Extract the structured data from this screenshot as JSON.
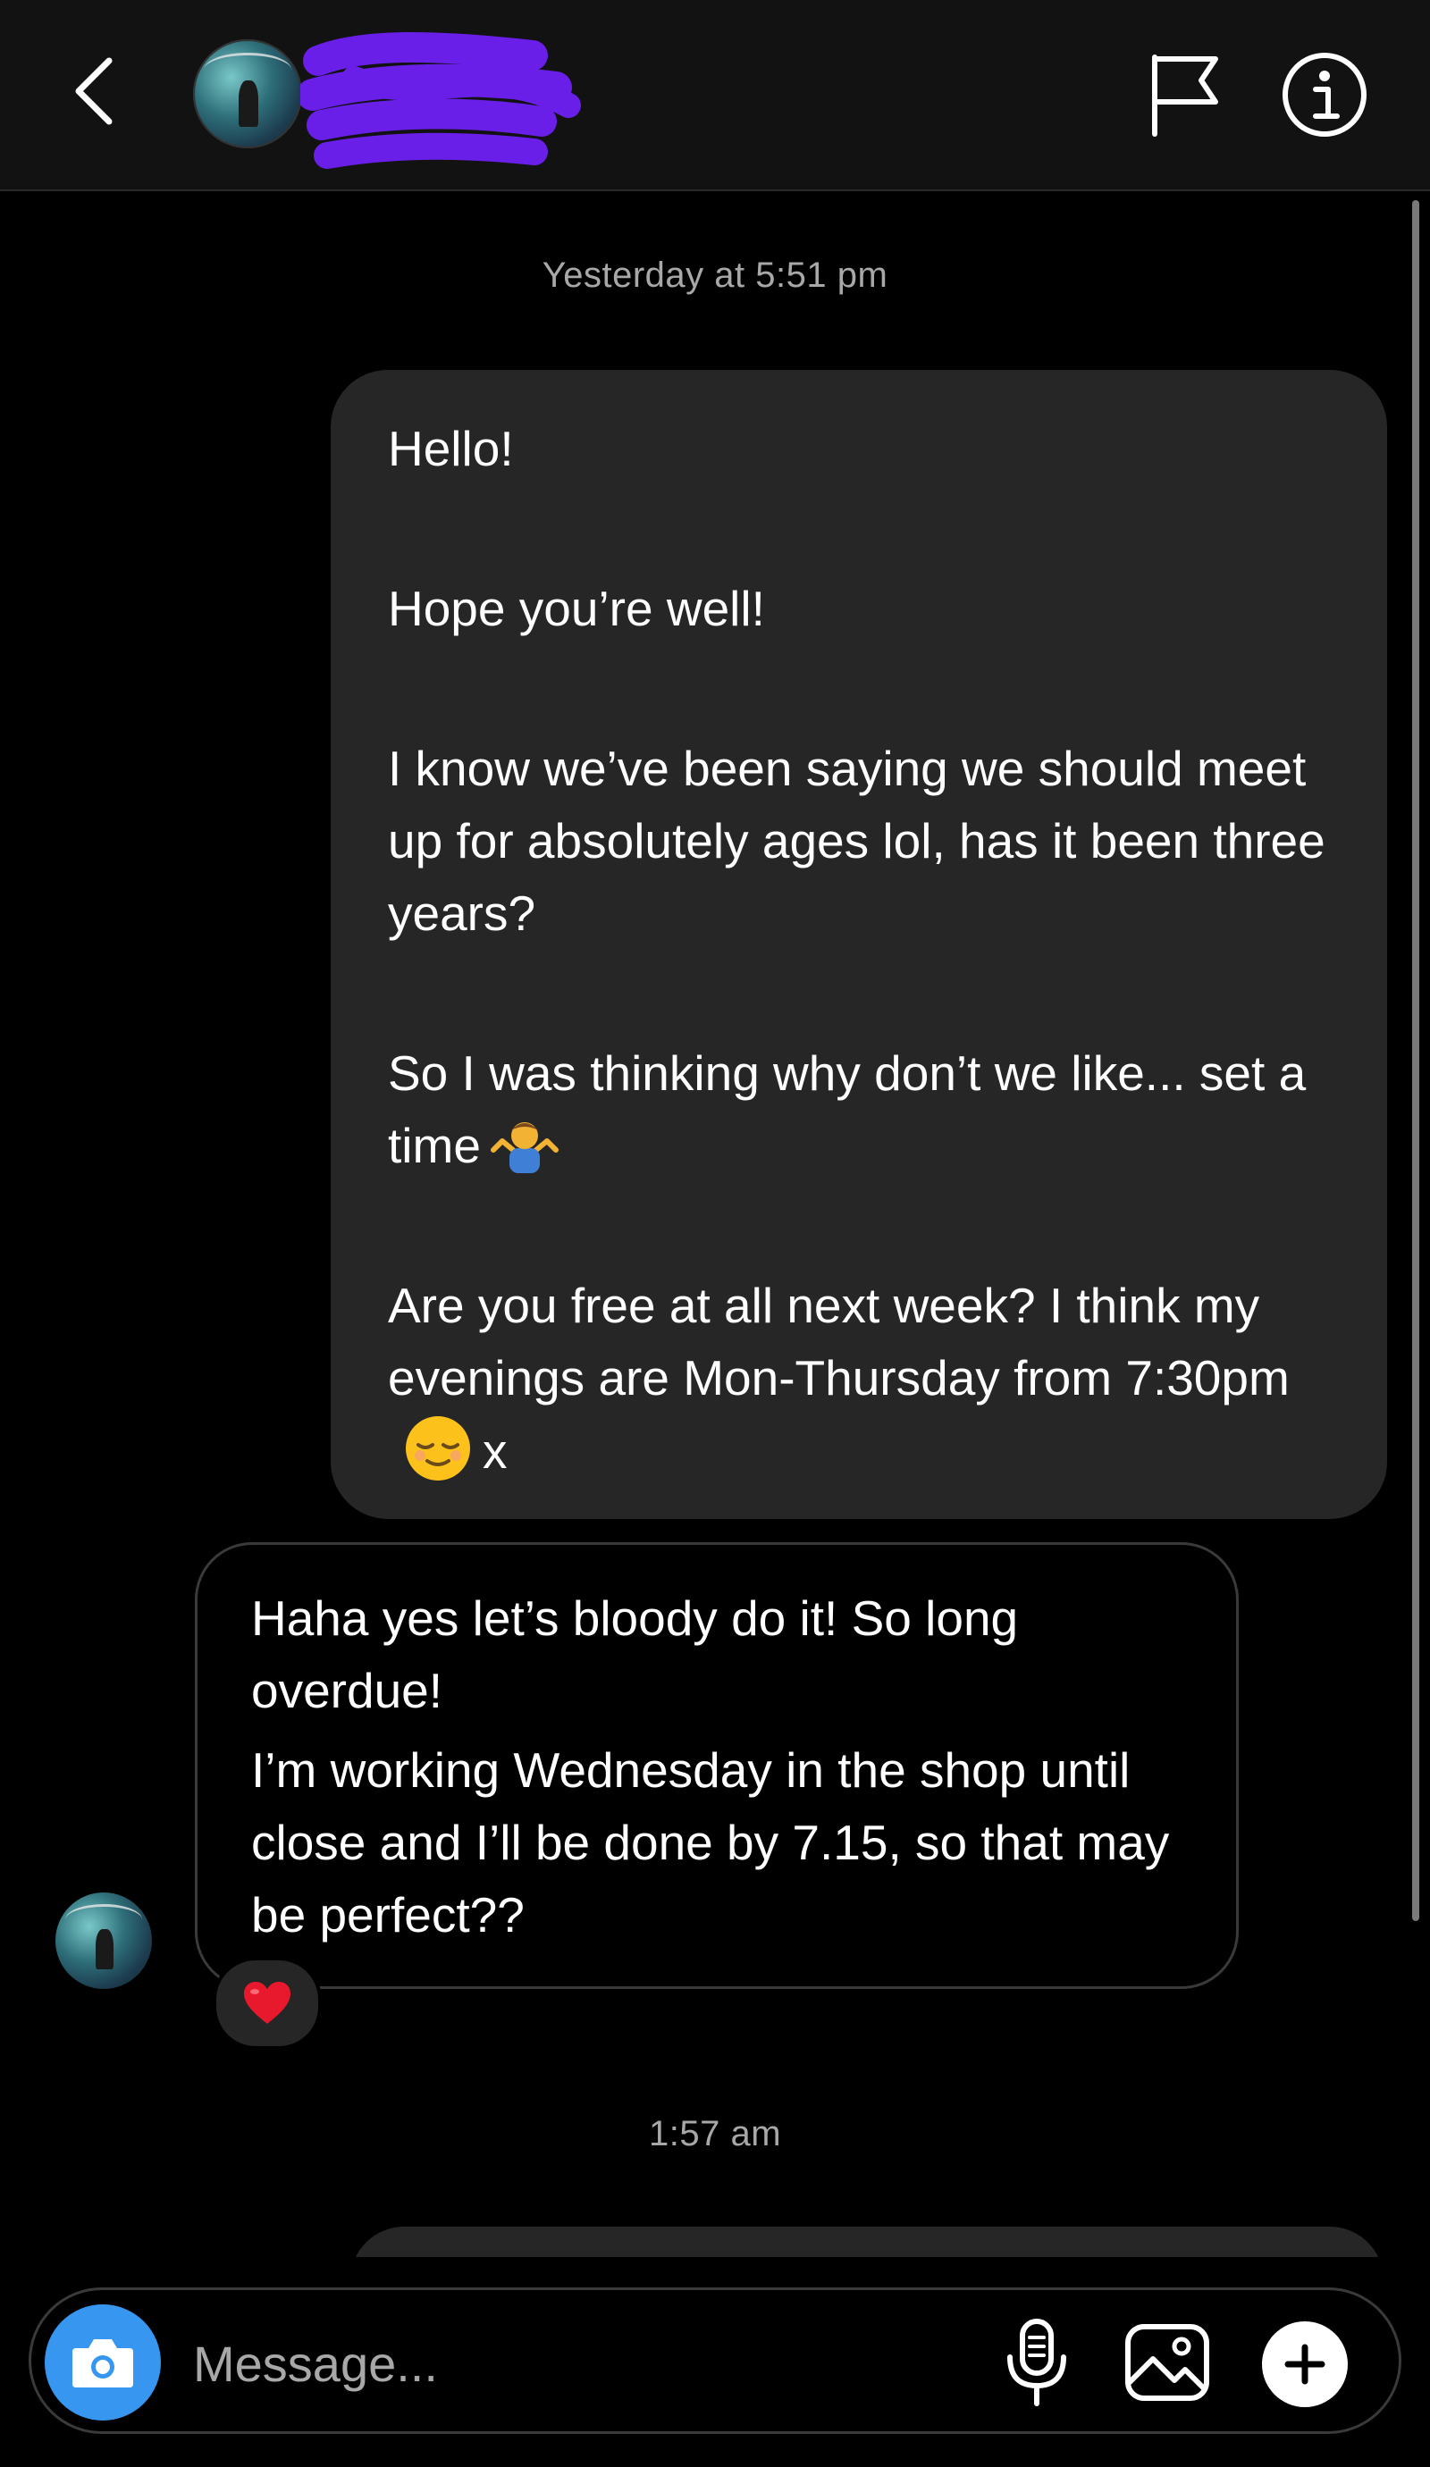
{
  "header": {
    "contact_name_redacted": true,
    "icons": [
      "chevron-left-icon",
      "flag-icon",
      "info-icon"
    ]
  },
  "thread": {
    "timestamp_1": "Yesterday at 5:51 pm",
    "sent_message": {
      "line_1": "Hello!",
      "line_2": "Hope you’re well!",
      "line_3": "I know we’ve been saying we should meet up for absolutely ages lol, has it been three years?",
      "line_4": "So I was thinking why don’t we like... set a time",
      "line_4_emoji": "🤷‍♂️",
      "line_5_text": "Are you free at all next week? I think my evenings are Mon-Thursday from 7:30pm",
      "line_5_emoji": "😌",
      "line_5_suffix": "x"
    },
    "received_message": {
      "line_1": "Haha yes let’s bloody do it! So long overdue!",
      "line_2": "I’m working Wednesday in the shop until close and I’ll be done by 7.15, so that may be perfect??",
      "reaction": "❤️"
    },
    "timestamp_2": "1:57 am"
  },
  "composer": {
    "placeholder": "Message...",
    "icons": [
      "camera-icon",
      "microphone-icon",
      "gallery-icon",
      "plus-icon"
    ]
  },
  "colors": {
    "background": "#000000",
    "header": "#121212",
    "sent_bubble": "#262626",
    "received_border": "#3a3a3a",
    "accent_blue": "#3797f0",
    "secondary_text": "#a8a8a8"
  }
}
